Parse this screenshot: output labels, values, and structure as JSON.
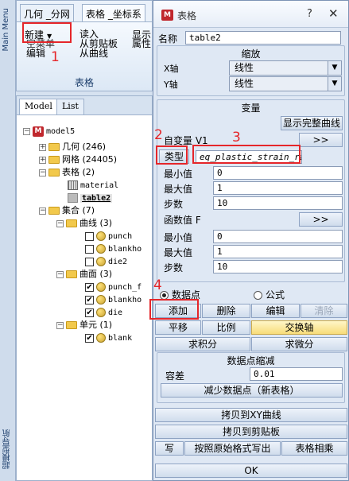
{
  "left_strip": {
    "top_label": "Main Menu",
    "bottom_label": "超模型导航"
  },
  "ribbon": {
    "tabs": [
      "几何 _分网",
      "表格 _坐标系"
    ],
    "buttons": {
      "new": "新建",
      "edit": "编辑",
      "empty_label": "空菜单",
      "read": "读入",
      "from_clipboard": "从剪贴板",
      "from_curve": "从曲线",
      "show": "显示",
      "attr": "属性"
    },
    "group_label": "表格"
  },
  "tree": {
    "tabs": [
      "Model",
      "List"
    ],
    "root": "model5",
    "items": [
      {
        "label": "几何 (246)"
      },
      {
        "label": "网格 (24405)"
      },
      {
        "label": "表格 (2)"
      },
      {
        "label": "material"
      },
      {
        "label": "table2"
      },
      {
        "label": "集合 (7)"
      },
      {
        "label": "曲线 (3)"
      },
      {
        "label": "punch"
      },
      {
        "label": "blankho"
      },
      {
        "label": "die2"
      },
      {
        "label": "曲面 (3)"
      },
      {
        "label": "punch_f"
      },
      {
        "label": "blankho"
      },
      {
        "label": "die"
      },
      {
        "label": "单元 (1)"
      },
      {
        "label": "blank"
      }
    ]
  },
  "dialog": {
    "title": "表格",
    "help": "?",
    "close": "✕",
    "name_label": "名称",
    "name_value": "table2",
    "scale_title": "缩放",
    "x_axis_label": "X轴",
    "x_axis_value": "线性",
    "y_axis_label": "Y轴",
    "y_axis_value": "线性",
    "variables_title": "变量",
    "show_full_curve": "显示完整曲线",
    "indep_var_label": "自变量 V1",
    "more_btn": ">>",
    "type_btn": "类型",
    "type_value": "eq_plastic_strain_rate",
    "v1_min_label": "最小值",
    "v1_min_value": "0",
    "v1_max_label": "最大值",
    "v1_max_value": "1",
    "v1_steps_label": "步数",
    "v1_steps_value": "10",
    "func_label": "函数值 F",
    "f_min_label": "最小值",
    "f_min_value": "0",
    "f_max_label": "最大值",
    "f_max_value": "1",
    "f_steps_label": "步数",
    "f_steps_value": "10",
    "radio_datapoints": "数据点",
    "radio_formula": "公式",
    "add": "添加",
    "delete": "删除",
    "edit": "编辑",
    "clear": "清除",
    "translate": "平移",
    "scale": "比例",
    "swap_axes": "交换轴",
    "integral": "求积分",
    "derivative": "求微分",
    "reduce_title": "数据点缩减",
    "tolerance_label": "容差",
    "tolerance_value": "0.01",
    "reduce_btn": "减少数据点（新表格）",
    "copy_xy": "拷贝到XY曲线",
    "copy_clip": "拷贝到剪贴板",
    "write": "写",
    "write_orig": "按照原始格式写出",
    "table_mult": "表格相乘",
    "ok": "OK"
  },
  "annotations": {
    "n1": "1",
    "n2": "2",
    "n3": "3",
    "n4": "4"
  },
  "colors": {
    "annotation": "#e5262a",
    "accent_yellow": "#f7dc7a"
  }
}
